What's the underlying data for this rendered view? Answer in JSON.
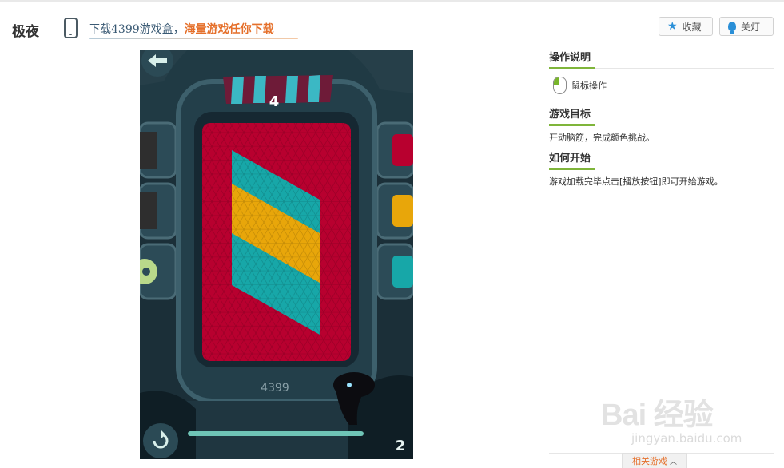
{
  "header": {
    "game_title": "极夜",
    "promo_part1": "下载4399游戏盒，",
    "promo_part2": "海量游戏任你下载",
    "favorite_label": "收藏",
    "lights_off_label": "关灯"
  },
  "game": {
    "level": "4",
    "brand": "4399",
    "moves_left": "2",
    "colors": {
      "board": "#b8002f",
      "teal": "#17a7a8",
      "yellow": "#e8a60a",
      "frame": "#1a2d36"
    }
  },
  "sidebar": {
    "controls_heading": "操作说明",
    "controls_text": "鼠标操作",
    "goal_heading": "游戏目标",
    "goal_text": "开动脑筋，完成颜色挑战。",
    "start_heading": "如何开始",
    "start_text": "游戏加载完毕点击[播放按钮]即可开始游戏。"
  },
  "footer": {
    "related_label": "相关游戏"
  },
  "watermark": {
    "logo": "Bai 经验",
    "url": "jingyan.baidu.com"
  },
  "icons": {
    "phone": "phone-icon",
    "star": "star-icon",
    "bulb": "bulb-icon",
    "mouse": "mouse-icon",
    "back": "back-arrow-icon",
    "restart": "restart-icon",
    "chevron": "chevron-up-icon"
  }
}
